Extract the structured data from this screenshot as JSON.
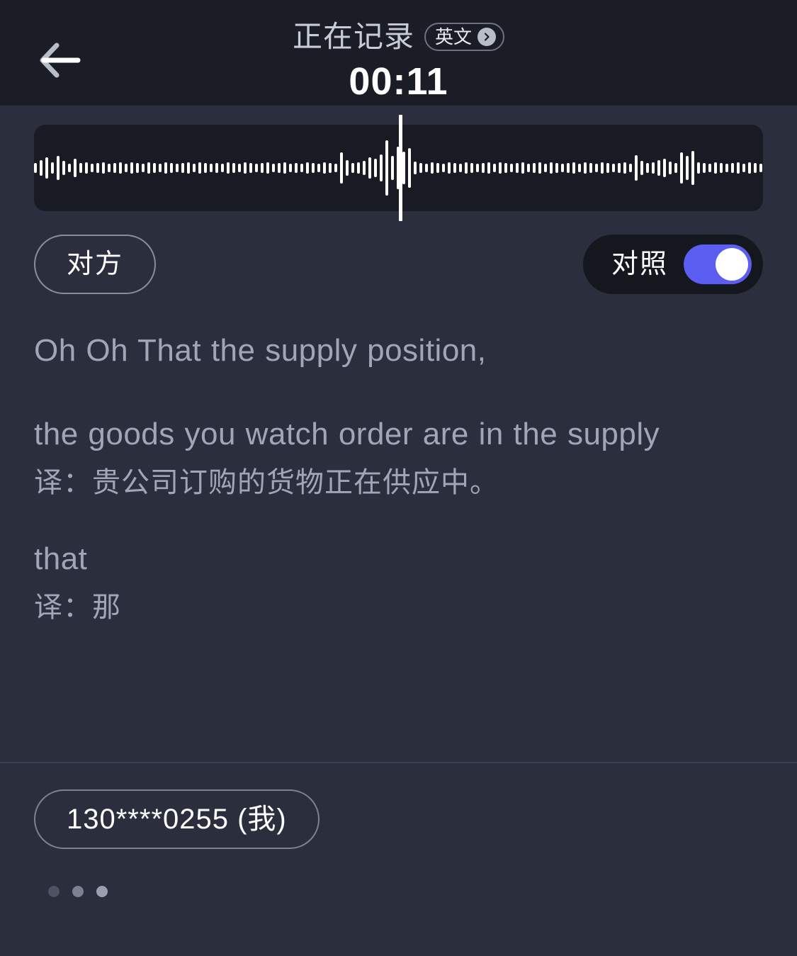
{
  "header": {
    "back_icon": "back-arrow-icon",
    "title": "正在记录",
    "language_badge": {
      "label": "英文",
      "chevron_icon": "chevron-right-circle-icon"
    },
    "timer": "00:11"
  },
  "waveform": {
    "playhead_position_percent": 50,
    "recorded_bar_heights": [
      14,
      22,
      30,
      16,
      34,
      20,
      12,
      26,
      14,
      16,
      12,
      14,
      16,
      12,
      14,
      16,
      12,
      16,
      14,
      12,
      16,
      14,
      12,
      16,
      14,
      12,
      14,
      16,
      12,
      16,
      14,
      12,
      14,
      12,
      16,
      14,
      12,
      16,
      14,
      12,
      14,
      16,
      12,
      14,
      16,
      12,
      14,
      12,
      16,
      14,
      12,
      16,
      14,
      12,
      44,
      22,
      14,
      16,
      20,
      30,
      26,
      38,
      78,
      34,
      60,
      46,
      56,
      18,
      14,
      12,
      16,
      14,
      12,
      16,
      14,
      12,
      16,
      14,
      12,
      14,
      16,
      12,
      16,
      14,
      12,
      14,
      16,
      12,
      14,
      16,
      12,
      16,
      14,
      12,
      14,
      16,
      12,
      16,
      14,
      12,
      16,
      14,
      12,
      14,
      16,
      12,
      36,
      20,
      14,
      16,
      22,
      26,
      18,
      14,
      44,
      34,
      48,
      16,
      14,
      12,
      16,
      14,
      12,
      14,
      16,
      12,
      16,
      14,
      12,
      14,
      16,
      12,
      16,
      14,
      12,
      16,
      14,
      12,
      14,
      16,
      12,
      16,
      14,
      12,
      22,
      30,
      26,
      34,
      22,
      16,
      14,
      12,
      16,
      14,
      12,
      14,
      16,
      12,
      16,
      14,
      12,
      14,
      16,
      12,
      16,
      14,
      12,
      16,
      14,
      12,
      14,
      16,
      12,
      16,
      14,
      12,
      16,
      14,
      12,
      14,
      16,
      12,
      16,
      14,
      20,
      26,
      22,
      18,
      16,
      14,
      12,
      16,
      14,
      12,
      14,
      16,
      12,
      16,
      14,
      12,
      14,
      16,
      12,
      16,
      14,
      12,
      14,
      16
    ],
    "future_bar_heights": [
      10,
      8,
      10,
      9,
      10,
      8,
      10,
      9,
      10,
      8,
      10,
      9,
      8,
      10,
      9,
      10,
      8,
      10,
      9,
      10,
      8,
      10,
      9,
      8,
      10,
      9,
      10,
      8,
      10,
      9,
      10,
      8,
      10,
      9,
      8,
      10,
      9,
      10,
      8,
      10,
      9,
      10,
      8,
      10,
      9,
      8,
      10,
      9,
      10,
      8,
      10,
      9,
      10,
      8,
      10,
      9,
      8,
      10,
      9,
      10,
      8,
      10,
      9,
      10,
      8,
      10,
      9,
      8,
      10,
      9,
      10,
      8,
      10,
      9,
      10,
      8,
      10,
      9,
      8,
      10,
      9,
      10,
      8,
      10,
      9,
      10,
      8,
      10,
      9,
      8,
      10,
      9,
      10,
      8,
      10,
      9,
      10,
      8,
      10,
      9,
      8,
      10,
      9,
      10,
      8,
      10,
      9,
      10,
      8,
      10,
      9,
      8,
      10,
      9,
      10,
      8,
      10,
      9,
      10,
      8,
      10,
      9,
      8,
      10,
      9,
      10,
      8,
      10,
      9,
      10,
      8,
      10,
      9,
      8,
      10,
      9,
      10,
      8,
      10,
      9,
      10,
      8,
      10,
      9,
      8,
      10,
      9,
      10,
      8,
      10,
      9,
      10,
      8,
      10,
      9,
      8,
      10,
      9,
      10,
      8,
      10,
      9,
      10,
      8,
      10,
      9,
      8,
      10,
      9,
      10,
      8,
      10,
      9,
      10,
      8,
      10,
      9,
      8,
      10,
      9,
      10,
      8,
      10,
      9,
      10,
      8,
      10,
      9,
      8,
      10,
      9,
      10,
      8,
      10,
      9,
      10,
      8,
      10,
      9,
      8,
      10,
      9,
      10,
      8,
      10,
      9,
      10,
      8,
      10,
      9,
      8,
      10,
      9,
      10,
      8,
      10
    ]
  },
  "controls": {
    "speaker_label": "对方",
    "compare_label": "对照",
    "compare_toggle_on": true,
    "toggle_accent_color": "#5b5ef0"
  },
  "transcript": {
    "segments": [
      {
        "source": "Oh Oh That the supply position,",
        "translation": "",
        "justified": false
      },
      {
        "source": "the goods you watch order are in the supply",
        "translation": "译：贵公司订购的货物正在供应中。",
        "justified": true
      },
      {
        "source": "that",
        "translation": "译：那",
        "justified": false
      }
    ]
  },
  "footer": {
    "me_pill_label": "130****0255 (我)",
    "loading_dots": 3
  },
  "colors": {
    "header_bg": "#1b1d26",
    "body_bg": "#2b2e3d",
    "wave_panel_bg": "#191b24",
    "text_primary": "#ffffff",
    "text_secondary": "#a0a6b8",
    "accent": "#5b5ef0"
  }
}
